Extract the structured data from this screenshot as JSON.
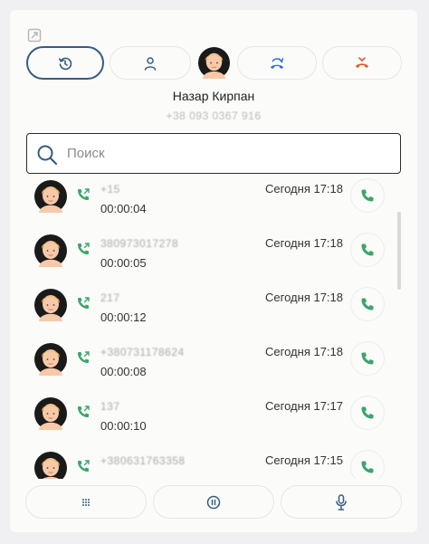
{
  "caller": {
    "name": "Назар Кирпан",
    "number": "+38 093 0367 916"
  },
  "top_buttons": [
    {
      "name": "history",
      "icon": "history-icon",
      "active": true
    },
    {
      "name": "contacts",
      "icon": "person-icon",
      "active": false
    },
    {
      "name": "transfer",
      "icon": "call-transfer-icon",
      "active": false
    },
    {
      "name": "hangup",
      "icon": "hangup-icon",
      "active": false
    }
  ],
  "search": {
    "placeholder": "Поиск",
    "value": ""
  },
  "calls": [
    {
      "number": "+15",
      "duration": "00:00:04",
      "time": "Сегодня 17:18"
    },
    {
      "number": "380973017278",
      "duration": "00:00:05",
      "time": "Сегодня 17:18"
    },
    {
      "number": "217",
      "duration": "00:00:12",
      "time": "Сегодня 17:18"
    },
    {
      "number": "+380731178624",
      "duration": "00:00:08",
      "time": "Сегодня 17:18"
    },
    {
      "number": "137",
      "duration": "00:00:10",
      "time": "Сегодня 17:17"
    },
    {
      "number": "+380631763358",
      "duration": "",
      "time": "Сегодня 17:15"
    }
  ],
  "bottom_buttons": [
    {
      "name": "keypad",
      "icon": "keypad-icon"
    },
    {
      "name": "hold",
      "icon": "pause-icon"
    },
    {
      "name": "mute",
      "icon": "microphone-icon"
    }
  ],
  "colors": {
    "accent": "#365d80",
    "outgoing_call": "#3ca56b",
    "transfer": "#2f6bd8",
    "hangup": "#e05a2a",
    "avatar_bg": "#1a1a1a",
    "avatar_hair": "#f3b34c",
    "avatar_skin": "#f7c9a9"
  }
}
